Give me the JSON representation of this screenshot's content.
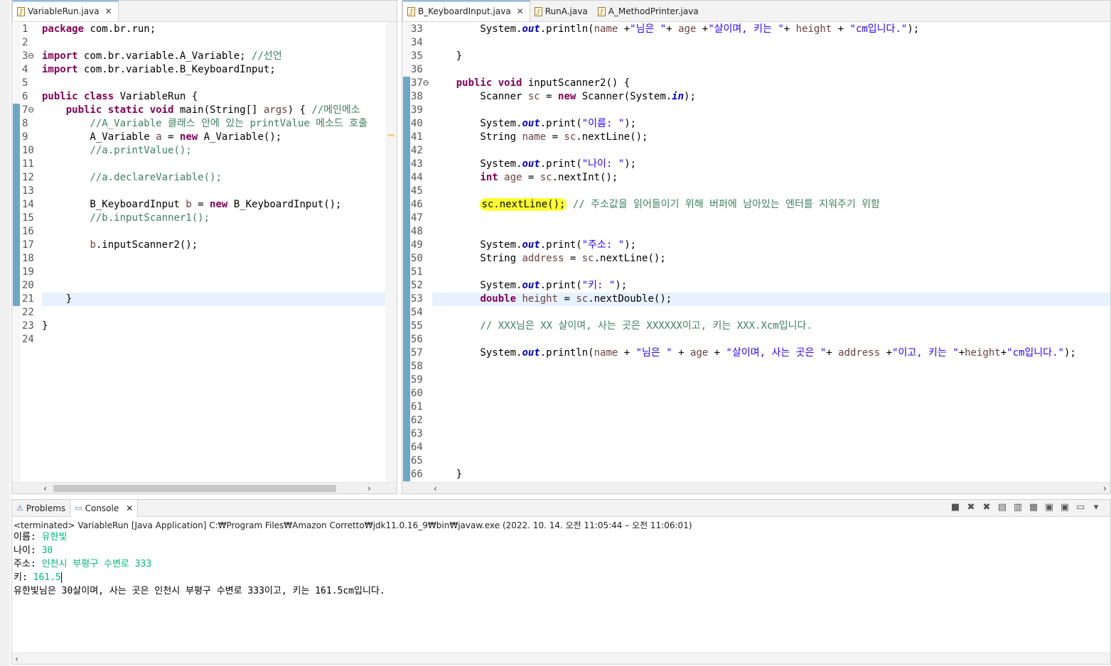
{
  "left_editor": {
    "tab_title": "VariableRun.java",
    "lines": [
      {
        "n": "1",
        "code": [
          {
            "t": "package",
            "c": "kw"
          },
          {
            "t": " com.br.run;"
          }
        ]
      },
      {
        "n": "2",
        "code": []
      },
      {
        "n": "3⊖",
        "code": [
          {
            "t": "import",
            "c": "kw"
          },
          {
            "t": " com.br.variable.A_Variable; "
          },
          {
            "t": "//선언",
            "c": "cm"
          }
        ]
      },
      {
        "n": "4",
        "code": [
          {
            "t": "import",
            "c": "kw"
          },
          {
            "t": " com.br.variable.B_KeyboardInput;"
          }
        ]
      },
      {
        "n": "5",
        "code": []
      },
      {
        "n": "6",
        "code": [
          {
            "t": "public class",
            "c": "kw"
          },
          {
            "t": " VariableRun {"
          }
        ]
      },
      {
        "n": "7⊖",
        "code": [
          {
            "t": "    "
          },
          {
            "t": "public static void",
            "c": "kw"
          },
          {
            "t": " main(String[] "
          },
          {
            "t": "args",
            "c": "vr"
          },
          {
            "t": ") { "
          },
          {
            "t": "//메인메소",
            "c": "cm"
          }
        ]
      },
      {
        "n": "8",
        "code": [
          {
            "t": "        "
          },
          {
            "t": "//A_Variable 클래스 안에 있는 printValue 메소드 호출",
            "c": "cm"
          }
        ]
      },
      {
        "n": "9",
        "code": [
          {
            "t": "        A_Variable "
          },
          {
            "t": "a",
            "c": "vr"
          },
          {
            "t": " = "
          },
          {
            "t": "new",
            "c": "kw"
          },
          {
            "t": " A_Variable();"
          }
        ]
      },
      {
        "n": "10",
        "code": [
          {
            "t": "        "
          },
          {
            "t": "//a.printValue();",
            "c": "cm"
          }
        ]
      },
      {
        "n": "11",
        "code": []
      },
      {
        "n": "12",
        "code": [
          {
            "t": "        "
          },
          {
            "t": "//a.declareVariable();",
            "c": "cm"
          }
        ]
      },
      {
        "n": "13",
        "code": []
      },
      {
        "n": "14",
        "code": [
          {
            "t": "        B_KeyboardInput "
          },
          {
            "t": "b",
            "c": "vr"
          },
          {
            "t": " = "
          },
          {
            "t": "new",
            "c": "kw"
          },
          {
            "t": " B_KeyboardInput();"
          }
        ]
      },
      {
        "n": "15",
        "code": [
          {
            "t": "        "
          },
          {
            "t": "//b.inputScanner1();",
            "c": "cm"
          }
        ]
      },
      {
        "n": "16",
        "code": []
      },
      {
        "n": "17",
        "code": [
          {
            "t": "        "
          },
          {
            "t": "b",
            "c": "vr"
          },
          {
            "t": ".inputScanner2();"
          }
        ]
      },
      {
        "n": "18",
        "code": []
      },
      {
        "n": "19",
        "code": []
      },
      {
        "n": "20",
        "code": []
      },
      {
        "n": "21",
        "code": [
          {
            "t": "    }"
          }
        ],
        "current": true
      },
      {
        "n": "22",
        "code": []
      },
      {
        "n": "23",
        "code": [
          {
            "t": "}"
          }
        ]
      },
      {
        "n": "24",
        "code": []
      }
    ]
  },
  "right_editor": {
    "tabs": [
      {
        "label": "B_KeyboardInput.java",
        "active": true
      },
      {
        "label": "RunA.java",
        "active": false
      },
      {
        "label": "A_MethodPrinter.java",
        "active": false
      }
    ],
    "lines": [
      {
        "n": "33",
        "code": [
          {
            "t": "        System."
          },
          {
            "t": "out",
            "c": "fd"
          },
          {
            "t": ".println("
          },
          {
            "t": "name",
            "c": "vr"
          },
          {
            "t": " +"
          },
          {
            "t": "\"님은 \"",
            "c": "st"
          },
          {
            "t": "+ "
          },
          {
            "t": "age",
            "c": "vr"
          },
          {
            "t": " +"
          },
          {
            "t": "\"살이며, 키는 \"",
            "c": "st"
          },
          {
            "t": "+ "
          },
          {
            "t": "height",
            "c": "vr"
          },
          {
            "t": " + "
          },
          {
            "t": "\"cm입니다.\"",
            "c": "st"
          },
          {
            "t": ");"
          }
        ]
      },
      {
        "n": "34",
        "code": []
      },
      {
        "n": "35",
        "code": [
          {
            "t": "    }"
          }
        ]
      },
      {
        "n": "36",
        "code": []
      },
      {
        "n": "37⊖",
        "code": [
          {
            "t": "    "
          },
          {
            "t": "public void",
            "c": "kw"
          },
          {
            "t": " inputScanner2() {"
          }
        ]
      },
      {
        "n": "38",
        "code": [
          {
            "t": "        Scanner "
          },
          {
            "t": "sc",
            "c": "vr"
          },
          {
            "t": " = "
          },
          {
            "t": "new",
            "c": "kw"
          },
          {
            "t": " Scanner(System."
          },
          {
            "t": "in",
            "c": "fd"
          },
          {
            "t": ");"
          }
        ]
      },
      {
        "n": "39",
        "code": []
      },
      {
        "n": "40",
        "code": [
          {
            "t": "        System."
          },
          {
            "t": "out",
            "c": "fd"
          },
          {
            "t": ".print("
          },
          {
            "t": "\"이름: \"",
            "c": "st"
          },
          {
            "t": ");"
          }
        ]
      },
      {
        "n": "41",
        "code": [
          {
            "t": "        String "
          },
          {
            "t": "name",
            "c": "vr"
          },
          {
            "t": " = "
          },
          {
            "t": "sc",
            "c": "vr"
          },
          {
            "t": ".nextLine();"
          }
        ]
      },
      {
        "n": "42",
        "code": []
      },
      {
        "n": "43",
        "code": [
          {
            "t": "        System."
          },
          {
            "t": "out",
            "c": "fd"
          },
          {
            "t": ".print("
          },
          {
            "t": "\"나이: \"",
            "c": "st"
          },
          {
            "t": ");"
          }
        ]
      },
      {
        "n": "44",
        "code": [
          {
            "t": "        "
          },
          {
            "t": "int",
            "c": "kw"
          },
          {
            "t": " "
          },
          {
            "t": "age",
            "c": "vr"
          },
          {
            "t": " = "
          },
          {
            "t": "sc",
            "c": "vr"
          },
          {
            "t": ".nextInt();"
          }
        ]
      },
      {
        "n": "45",
        "code": []
      },
      {
        "n": "46",
        "code": [
          {
            "t": "        "
          },
          {
            "t": "sc.nextLine();",
            "c": "hl"
          },
          {
            "t": " "
          },
          {
            "t": "// 주소값을 읽어들이기 위해 버퍼에 남아있는 엔터를 지워주기 위함",
            "c": "cm"
          }
        ]
      },
      {
        "n": "47",
        "code": []
      },
      {
        "n": "48",
        "code": []
      },
      {
        "n": "49",
        "code": [
          {
            "t": "        System."
          },
          {
            "t": "out",
            "c": "fd"
          },
          {
            "t": ".print("
          },
          {
            "t": "\"주소: \"",
            "c": "st"
          },
          {
            "t": ");"
          }
        ]
      },
      {
        "n": "50",
        "code": [
          {
            "t": "        String "
          },
          {
            "t": "address",
            "c": "vr"
          },
          {
            "t": " = "
          },
          {
            "t": "sc",
            "c": "vr"
          },
          {
            "t": ".nextLine();"
          }
        ]
      },
      {
        "n": "51",
        "code": []
      },
      {
        "n": "52",
        "code": [
          {
            "t": "        System."
          },
          {
            "t": "out",
            "c": "fd"
          },
          {
            "t": ".print("
          },
          {
            "t": "\"키: \"",
            "c": "st"
          },
          {
            "t": ");"
          }
        ]
      },
      {
        "n": "53",
        "code": [
          {
            "t": "        "
          },
          {
            "t": "double",
            "c": "kw"
          },
          {
            "t": " "
          },
          {
            "t": "height",
            "c": "vr"
          },
          {
            "t": " = "
          },
          {
            "t": "sc",
            "c": "vr"
          },
          {
            "t": ".nextDouble();"
          }
        ],
        "current": true
      },
      {
        "n": "54",
        "code": []
      },
      {
        "n": "55",
        "code": [
          {
            "t": "        "
          },
          {
            "t": "// XXX님은 XX 살이며, 사는 곳은 XXXXXX이고, 키는 XXX.Xcm입니다.",
            "c": "cm"
          }
        ]
      },
      {
        "n": "56",
        "code": []
      },
      {
        "n": "57",
        "code": [
          {
            "t": "        System."
          },
          {
            "t": "out",
            "c": "fd"
          },
          {
            "t": ".println("
          },
          {
            "t": "name",
            "c": "vr"
          },
          {
            "t": " + "
          },
          {
            "t": "\"님은 \"",
            "c": "st"
          },
          {
            "t": " + "
          },
          {
            "t": "age",
            "c": "vr"
          },
          {
            "t": " + "
          },
          {
            "t": "\"살이며, 사는 곳은 \"",
            "c": "st"
          },
          {
            "t": "+ "
          },
          {
            "t": "address",
            "c": "vr"
          },
          {
            "t": " +"
          },
          {
            "t": "\"이고, 키는 \"",
            "c": "st"
          },
          {
            "t": "+"
          },
          {
            "t": "height",
            "c": "vr"
          },
          {
            "t": "+"
          },
          {
            "t": "\"cm입니다.\"",
            "c": "st"
          },
          {
            "t": ");"
          }
        ]
      },
      {
        "n": "58",
        "code": []
      },
      {
        "n": "59",
        "code": []
      },
      {
        "n": "60",
        "code": []
      },
      {
        "n": "61",
        "code": []
      },
      {
        "n": "62",
        "code": []
      },
      {
        "n": "63",
        "code": []
      },
      {
        "n": "64",
        "code": []
      },
      {
        "n": "65",
        "code": []
      },
      {
        "n": "66",
        "code": [
          {
            "t": "    }"
          }
        ]
      }
    ]
  },
  "console": {
    "tabs": [
      {
        "label": "Problems",
        "icon": "problems-icon",
        "active": false
      },
      {
        "label": "Console",
        "icon": "console-icon",
        "active": true
      }
    ],
    "header": "<terminated> VariableRun [Java Application] C:₩Program Files₩Amazon Corretto₩jdk11.0.16_9₩bin₩javaw.exe  (2022. 10. 14. 오전 11:05:44 – 오전 11:06:01)",
    "output": [
      {
        "prompt": "이름: ",
        "input": "유한빛"
      },
      {
        "prompt": "나이: ",
        "input": "30"
      },
      {
        "prompt": "주소: ",
        "input": "인천시 부평구 수변로 333"
      },
      {
        "prompt": "키: ",
        "input": "161.5"
      },
      {
        "prompt": "유한빛님은 30살이며, 사는 곳은 인천시 부평구 수변로 333이고, 키는 161.5cm입니다.",
        "input": ""
      }
    ],
    "toolbar_icons": [
      "terminate-icon",
      "remove-launch-icon",
      "remove-all-icon",
      "clear-console-icon",
      "scroll-lock-icon",
      "word-wrap-icon",
      "pin-console-icon",
      "show-on-output-icon",
      "display-selected-console-icon",
      "open-console-icon"
    ]
  },
  "colors": {
    "keyword": "#7f0055",
    "comment": "#3f7f5f",
    "string": "#2a00ff",
    "field": "#0000c0",
    "console_input": "#00b877",
    "highlight": "#ffff33",
    "change_marker": "#6fa5c6"
  }
}
